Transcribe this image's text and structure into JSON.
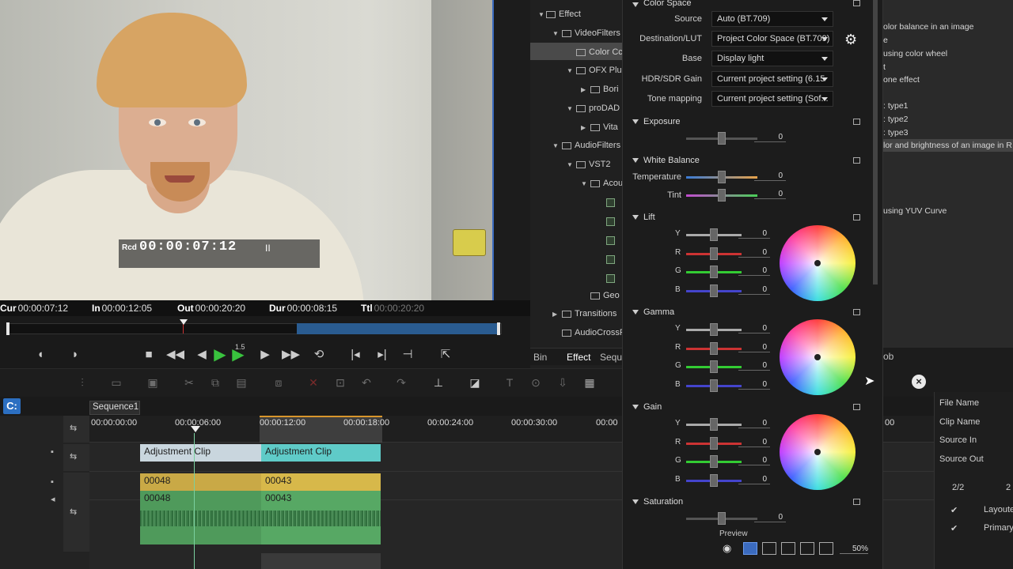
{
  "preview": {
    "rec_label": "Rcd",
    "timecode": "00:00:07:12",
    "pause_icon": "II"
  },
  "timecodes": {
    "cur_label": "Cur",
    "cur": "00:00:07:12",
    "in_label": "In",
    "in": "00:00:12:05",
    "out_label": "Out",
    "out": "00:00:20:20",
    "dur_label": "Dur",
    "dur": "00:00:08:15",
    "ttl_label": "Ttl",
    "ttl": "00:00:20:20"
  },
  "transport": {
    "speed": "1.5"
  },
  "bin_tree": {
    "effect": "Effect",
    "video_filters": "VideoFilters",
    "color_correction": "Color Cc",
    "ofx": "OFX Plu",
    "bori": "Bori",
    "prodad": "proDAD",
    "vita": "Vita",
    "audio_filters": "AudioFilters",
    "vst2": "VST2",
    "acou": "Acou",
    "geo": "Geo",
    "transitions": "Transitions",
    "audio_cross": "AudioCrossF"
  },
  "bin_tabs": {
    "bin": "Bin",
    "effect": "Effect",
    "seq": "Sequ"
  },
  "fx_descriptions": [
    "olor balance in an image",
    "e",
    "using color wheel",
    "t",
    "one effect",
    "",
    ": type1",
    ": type2",
    ": type3",
    "lor and brightness of an image in R",
    "",
    "",
    "",
    "using YUV Curve"
  ],
  "fx_desc_tab": "ob",
  "properties": {
    "file_name": "File Name",
    "clip_name": "Clip Name",
    "source_in": "Source In",
    "source_out": "Source Out",
    "page": "2/2",
    "layouter": "Layouter",
    "primary": "Primary",
    "extra": "2"
  },
  "timeline": {
    "sequence_tab": "Sequence1",
    "ruler": [
      "00:00:00:00",
      "00:00:06:00",
      "00:00:12:00",
      "00:00:18:00",
      "00:00:24:00",
      "00:00:30:00",
      "00:00"
    ],
    "ruler_right": "00",
    "clips": {
      "adj1": "Adjustment Clip",
      "adj2": "Adjustment Clip",
      "v1a": "00048",
      "v1b": "00043",
      "a1a": "00048",
      "a1b": "00043"
    }
  },
  "color_panel": {
    "color_space": "Color Space",
    "source_label": "Source",
    "source_value": "Auto (BT.709)",
    "dest_label": "Destination/LUT",
    "dest_value": "Project Color Space (BT.709)",
    "base_label": "Base",
    "base_value": "Display light",
    "hdr_label": "HDR/SDR Gain",
    "hdr_value": "Current project setting (6.15",
    "tone_label": "Tone mapping",
    "tone_value": "Current project setting (Sof...",
    "exposure": "Exposure",
    "exposure_val": "0",
    "white_balance": "White Balance",
    "temperature": "Temperature",
    "temperature_val": "0",
    "tint": "Tint",
    "tint_val": "0",
    "lift": "Lift",
    "gamma": "Gamma",
    "gain": "Gain",
    "saturation": "Saturation",
    "saturation_val": "0",
    "ch_y": "Y",
    "ch_r": "R",
    "ch_g": "G",
    "ch_b": "B",
    "zero": "0",
    "preview": "Preview",
    "zoom": "50%"
  }
}
